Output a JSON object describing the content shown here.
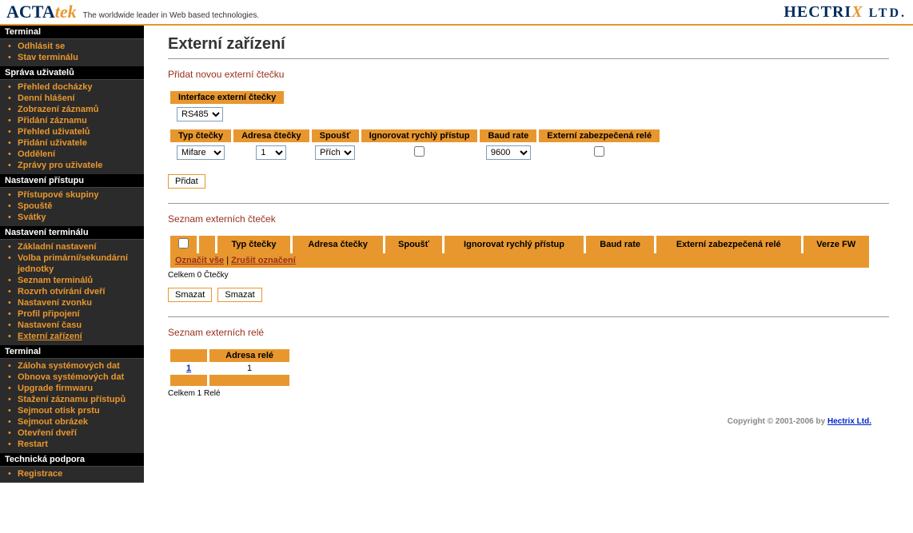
{
  "header": {
    "logo_a": "ACTA",
    "logo_b": "tek",
    "tagline": "The worldwide leader in Web based technologies.",
    "right_a": "HECTRI",
    "right_b": "X",
    "right_c": " LTD."
  },
  "nav": {
    "s0": "Terminal",
    "s0_items": [
      "Odhlásit se",
      "Stav terminálu"
    ],
    "s1": "Správa uživatelů",
    "s1_items": [
      "Přehled docházky",
      "Denní hlášení",
      "Zobrazení záznamů",
      "Přidání záznamu",
      "Přehled uživatelů",
      "Přidání uživatele",
      "Oddělení",
      "Zprávy pro uživatele"
    ],
    "s2": "Nastavení přístupu",
    "s2_items": [
      "Přístupové skupiny",
      "Spouště",
      "Svátky"
    ],
    "s3": "Nastavení terminálu",
    "s3_items": [
      "Základní nastavení",
      "Volba primární/sekundární jednotky",
      "Seznam terminálů",
      "Rozvrh otvírání dveří",
      "Nastavení zvonku",
      "Profil připojení",
      "Nastavení času",
      "Externí zařízení"
    ],
    "s4": "Terminal",
    "s4_items": [
      "Záloha systémových dat",
      "Obnova systémových dat",
      "Upgrade firmwaru",
      "Stažení záznamu přístupů",
      "Sejmout otisk prstu",
      "Sejmout obrázek",
      "Otevření dveří",
      "Restart"
    ],
    "s5": "Technická podpora",
    "s5_items": [
      "Registrace"
    ]
  },
  "page": {
    "title": "Externí zařízení",
    "add_reader_head": "Přidat novou externí čtečku",
    "iface_label": "Interface externí čtečky",
    "iface_value": "RS485",
    "cols": {
      "type": "Typ čtečky",
      "addr": "Adresa čtečky",
      "trigger": "Spoušť",
      "ignore": "Ignorovat rychlý přístup",
      "baud": "Baud rate",
      "relay": "Externí zabezpečená relé",
      "fw": "Verze FW"
    },
    "vals": {
      "type": "Mifare",
      "addr": "1",
      "trigger": "Přích.",
      "baud": "9600"
    },
    "add_btn": "Přidat",
    "list_head": "Seznam externích čteček",
    "select_all": "Označit vše",
    "sep": " | ",
    "deselect_all": "Zrušit označení",
    "count_readers": "Celkem 0 Čtečky",
    "delete_btn": "Smazat",
    "relay_head": "Seznam externích relé",
    "relay_addr": "Adresa relé",
    "relay_row": {
      "id": "1",
      "addr": "1"
    },
    "count_relays": "Celkem 1 Relé",
    "copyright": "Copyright © 2001-2006 by ",
    "copyright_link": "Hectrix Ltd."
  }
}
